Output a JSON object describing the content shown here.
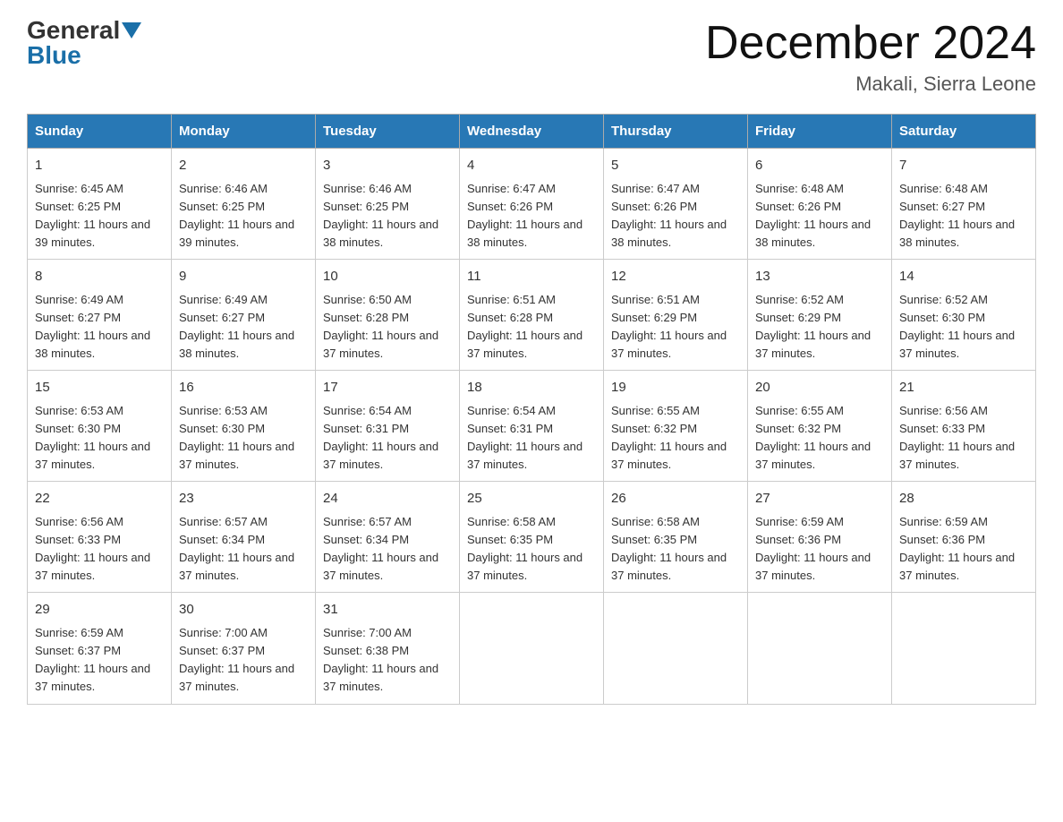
{
  "header": {
    "logo_general": "General",
    "logo_blue": "Blue",
    "title": "December 2024",
    "subtitle": "Makali, Sierra Leone"
  },
  "weekdays": [
    "Sunday",
    "Monday",
    "Tuesday",
    "Wednesday",
    "Thursday",
    "Friday",
    "Saturday"
  ],
  "weeks": [
    [
      {
        "day": "1",
        "sunrise": "6:45 AM",
        "sunset": "6:25 PM",
        "daylight": "11 hours and 39 minutes."
      },
      {
        "day": "2",
        "sunrise": "6:46 AM",
        "sunset": "6:25 PM",
        "daylight": "11 hours and 39 minutes."
      },
      {
        "day": "3",
        "sunrise": "6:46 AM",
        "sunset": "6:25 PM",
        "daylight": "11 hours and 38 minutes."
      },
      {
        "day": "4",
        "sunrise": "6:47 AM",
        "sunset": "6:26 PM",
        "daylight": "11 hours and 38 minutes."
      },
      {
        "day": "5",
        "sunrise": "6:47 AM",
        "sunset": "6:26 PM",
        "daylight": "11 hours and 38 minutes."
      },
      {
        "day": "6",
        "sunrise": "6:48 AM",
        "sunset": "6:26 PM",
        "daylight": "11 hours and 38 minutes."
      },
      {
        "day": "7",
        "sunrise": "6:48 AM",
        "sunset": "6:27 PM",
        "daylight": "11 hours and 38 minutes."
      }
    ],
    [
      {
        "day": "8",
        "sunrise": "6:49 AM",
        "sunset": "6:27 PM",
        "daylight": "11 hours and 38 minutes."
      },
      {
        "day": "9",
        "sunrise": "6:49 AM",
        "sunset": "6:27 PM",
        "daylight": "11 hours and 38 minutes."
      },
      {
        "day": "10",
        "sunrise": "6:50 AM",
        "sunset": "6:28 PM",
        "daylight": "11 hours and 37 minutes."
      },
      {
        "day": "11",
        "sunrise": "6:51 AM",
        "sunset": "6:28 PM",
        "daylight": "11 hours and 37 minutes."
      },
      {
        "day": "12",
        "sunrise": "6:51 AM",
        "sunset": "6:29 PM",
        "daylight": "11 hours and 37 minutes."
      },
      {
        "day": "13",
        "sunrise": "6:52 AM",
        "sunset": "6:29 PM",
        "daylight": "11 hours and 37 minutes."
      },
      {
        "day": "14",
        "sunrise": "6:52 AM",
        "sunset": "6:30 PM",
        "daylight": "11 hours and 37 minutes."
      }
    ],
    [
      {
        "day": "15",
        "sunrise": "6:53 AM",
        "sunset": "6:30 PM",
        "daylight": "11 hours and 37 minutes."
      },
      {
        "day": "16",
        "sunrise": "6:53 AM",
        "sunset": "6:30 PM",
        "daylight": "11 hours and 37 minutes."
      },
      {
        "day": "17",
        "sunrise": "6:54 AM",
        "sunset": "6:31 PM",
        "daylight": "11 hours and 37 minutes."
      },
      {
        "day": "18",
        "sunrise": "6:54 AM",
        "sunset": "6:31 PM",
        "daylight": "11 hours and 37 minutes."
      },
      {
        "day": "19",
        "sunrise": "6:55 AM",
        "sunset": "6:32 PM",
        "daylight": "11 hours and 37 minutes."
      },
      {
        "day": "20",
        "sunrise": "6:55 AM",
        "sunset": "6:32 PM",
        "daylight": "11 hours and 37 minutes."
      },
      {
        "day": "21",
        "sunrise": "6:56 AM",
        "sunset": "6:33 PM",
        "daylight": "11 hours and 37 minutes."
      }
    ],
    [
      {
        "day": "22",
        "sunrise": "6:56 AM",
        "sunset": "6:33 PM",
        "daylight": "11 hours and 37 minutes."
      },
      {
        "day": "23",
        "sunrise": "6:57 AM",
        "sunset": "6:34 PM",
        "daylight": "11 hours and 37 minutes."
      },
      {
        "day": "24",
        "sunrise": "6:57 AM",
        "sunset": "6:34 PM",
        "daylight": "11 hours and 37 minutes."
      },
      {
        "day": "25",
        "sunrise": "6:58 AM",
        "sunset": "6:35 PM",
        "daylight": "11 hours and 37 minutes."
      },
      {
        "day": "26",
        "sunrise": "6:58 AM",
        "sunset": "6:35 PM",
        "daylight": "11 hours and 37 minutes."
      },
      {
        "day": "27",
        "sunrise": "6:59 AM",
        "sunset": "6:36 PM",
        "daylight": "11 hours and 37 minutes."
      },
      {
        "day": "28",
        "sunrise": "6:59 AM",
        "sunset": "6:36 PM",
        "daylight": "11 hours and 37 minutes."
      }
    ],
    [
      {
        "day": "29",
        "sunrise": "6:59 AM",
        "sunset": "6:37 PM",
        "daylight": "11 hours and 37 minutes."
      },
      {
        "day": "30",
        "sunrise": "7:00 AM",
        "sunset": "6:37 PM",
        "daylight": "11 hours and 37 minutes."
      },
      {
        "day": "31",
        "sunrise": "7:00 AM",
        "sunset": "6:38 PM",
        "daylight": "11 hours and 37 minutes."
      },
      null,
      null,
      null,
      null
    ]
  ]
}
